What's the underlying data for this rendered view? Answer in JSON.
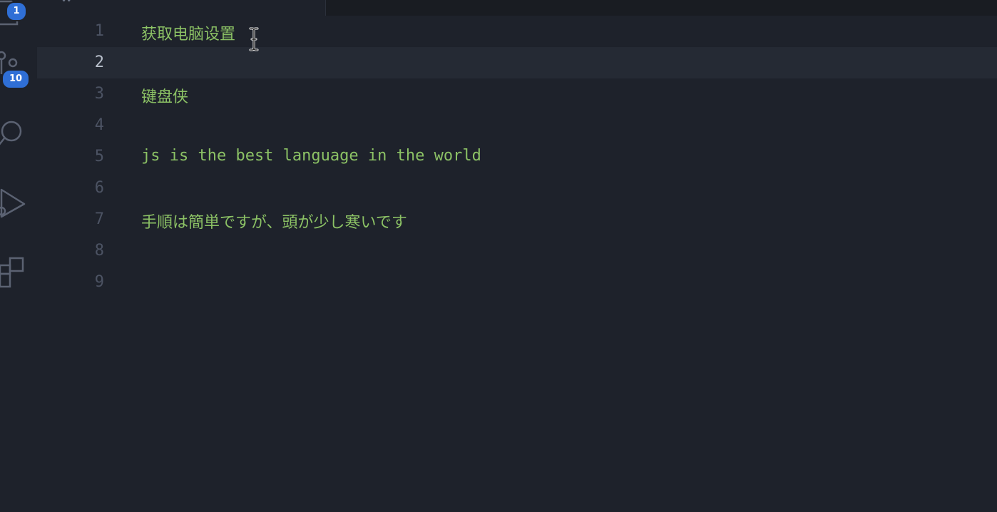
{
  "activity_bar": {
    "items": [
      {
        "name": "explorer-icon",
        "badge": "1"
      },
      {
        "name": "source-control-icon",
        "badge": "10"
      },
      {
        "name": "search-icon"
      },
      {
        "name": "run-debug-icon"
      },
      {
        "name": "extensions-icon"
      }
    ]
  },
  "editor": {
    "current_line": 2,
    "lines": [
      {
        "number": "1",
        "text": "获取电脑设置"
      },
      {
        "number": "2",
        "text": ""
      },
      {
        "number": "3",
        "text": "键盘侠"
      },
      {
        "number": "4",
        "text": ""
      },
      {
        "number": "5",
        "text": "js is the best language in the world"
      },
      {
        "number": "6",
        "text": ""
      },
      {
        "number": "7",
        "text": "手順は簡単ですが、頭が少し寒いです"
      },
      {
        "number": "8",
        "text": ""
      },
      {
        "number": "9",
        "text": ""
      }
    ]
  },
  "colors": {
    "background": "#1e222b",
    "line_number": "#4c5363",
    "line_number_active": "#b9c0cc",
    "text": "#8cc265",
    "current_line_highlight": "#252a34",
    "badge": "#2f6fd6"
  }
}
